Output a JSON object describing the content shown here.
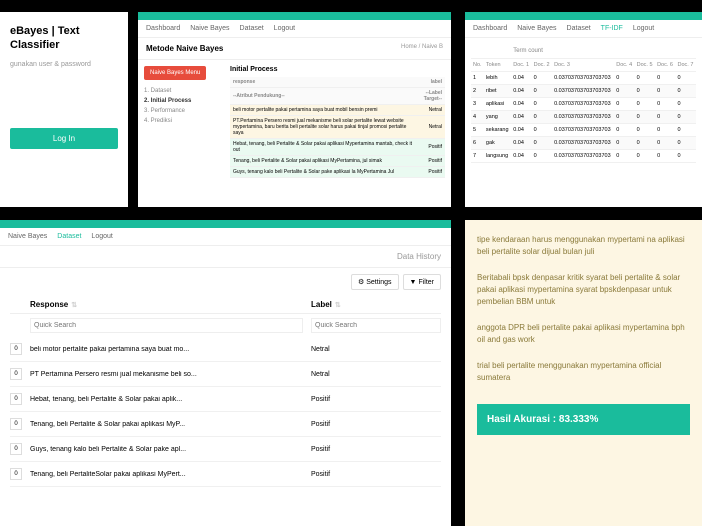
{
  "login": {
    "title": "eBayes | Text Classifier",
    "subtitle": "gunakan user & password",
    "button": "Log In"
  },
  "nav_items": [
    "Dashboard",
    "Naive Bayes",
    "Dataset",
    "Logout"
  ],
  "nav_tfidf": [
    "Dashboard",
    "Naive Bayes",
    "Dataset",
    "TF-IDF",
    "Logout"
  ],
  "naive": {
    "title": "Metode Naive Bayes",
    "crumb": "Home / Naive B",
    "menu_btn": "Naive Bayes Menu",
    "steps": [
      "1. Dataset",
      "2. Initial Process",
      "3. Performance",
      "4. Prediksi"
    ],
    "proc_title": "Initial Process",
    "th_resp": "response",
    "th_label": "label",
    "th_attr": "--Atribut Pendukung--",
    "th_target": "--Label Target--",
    "rows": [
      {
        "r": "beli motor pertalite pakai pertamina saya buat mobil bensin premi",
        "l": "Netral",
        "c": "netral"
      },
      {
        "r": "PT.Pertamina Persero resmi jual mekanisme beli solar pertalite lewat website mypertamina, baru berita beli pertalite solar harus pakai tinjal promosi pertalite saya",
        "l": "Netral",
        "c": "netral"
      },
      {
        "r": "Hebat, tenang, beli Pertalite & Solar pakai aplikasi Mypertamina mantab, check it out",
        "l": "Positif",
        "c": "positif"
      },
      {
        "r": "Tenang, beli Pertalite & Solar pakai aplikasi MyPertamina, jul simak",
        "l": "Positif",
        "c": "positif"
      },
      {
        "r": "Guys, tenang kalo beli Pertalite & Solar pake aplikasi la MyPertamina Jul",
        "l": "Positif",
        "c": "positif"
      }
    ]
  },
  "tfidf": {
    "tc_label": "Term count",
    "th": [
      "No.",
      "Token",
      "Doc. 1",
      "Doc. 2",
      "Doc. 3",
      "Doc. 4",
      "Doc. 5",
      "Doc. 6",
      "Doc. 7"
    ],
    "rows": [
      [
        "1",
        "lebih",
        "0.04",
        "0",
        "0.03703703703703703",
        "0",
        "0",
        "0",
        "0"
      ],
      [
        "2",
        "ribet",
        "0.04",
        "0",
        "0.03703703703703703",
        "0",
        "0",
        "0",
        "0"
      ],
      [
        "3",
        "aplikasi",
        "0.04",
        "0",
        "0.03703703703703703",
        "0",
        "0",
        "0",
        "0"
      ],
      [
        "4",
        "yang",
        "0.04",
        "0",
        "0.03703703703703703",
        "0",
        "0",
        "0",
        "0"
      ],
      [
        "5",
        "sekarang",
        "0.04",
        "0",
        "0.03703703703703703",
        "0",
        "0",
        "0",
        "0"
      ],
      [
        "6",
        "gak",
        "0.04",
        "0",
        "0.03703703703703703",
        "0",
        "0",
        "0",
        "0"
      ],
      [
        "7",
        "langsung",
        "0.04",
        "0",
        "0.03703703703703703",
        "0",
        "0",
        "0",
        "0"
      ]
    ]
  },
  "dataset": {
    "nav": [
      "Naive Bayes",
      "Dataset",
      "Logout"
    ],
    "history": "Data History",
    "settings": "Settings",
    "filter": "Filter",
    "th_resp": "Response",
    "th_label": "Label",
    "search_ph": "Quick Search",
    "rows": [
      {
        "n": "0",
        "r": "beli motor pertalite pakai pertamina saya buat mo...",
        "l": "Netral"
      },
      {
        "n": "0",
        "r": "PT Pertamina Persero resmi jual mekanisme beli so...",
        "l": "Netral"
      },
      {
        "n": "0",
        "r": "Hebat, tenang, beli Pertalite & Solar pakai aplik...",
        "l": "Positif"
      },
      {
        "n": "0",
        "r": "Tenang, beli Pertalite & Solar pakai aplikasi MyP...",
        "l": "Positif"
      },
      {
        "n": "0",
        "r": "Guys, tenang kalo beli Pertalite & Solar pake apl...",
        "l": "Positif"
      },
      {
        "n": "0",
        "r": "Tenang, beli PertaliteSolar pakai aplikasi MyPert...",
        "l": "Positif"
      }
    ]
  },
  "result": {
    "p1": "tipe kendaraan harus menggunakan mypertami na aplikasi beli pertalite solar dijual bulan juli",
    "p2": "Beritabali bpsk denpasar kritik syarat beli pertalite & solar pakai aplikasi mypertamina syarat bpskdenpasar untuk pembelian BBM untuk",
    "p3": "anggota DPR beli pertalite pakai aplikasi mypertamina bph oil and gas work",
    "p4": "trial beli pertalite menggunakan mypertamina official sumatera",
    "acc": "Hasil Akurasi : 83.333%"
  }
}
